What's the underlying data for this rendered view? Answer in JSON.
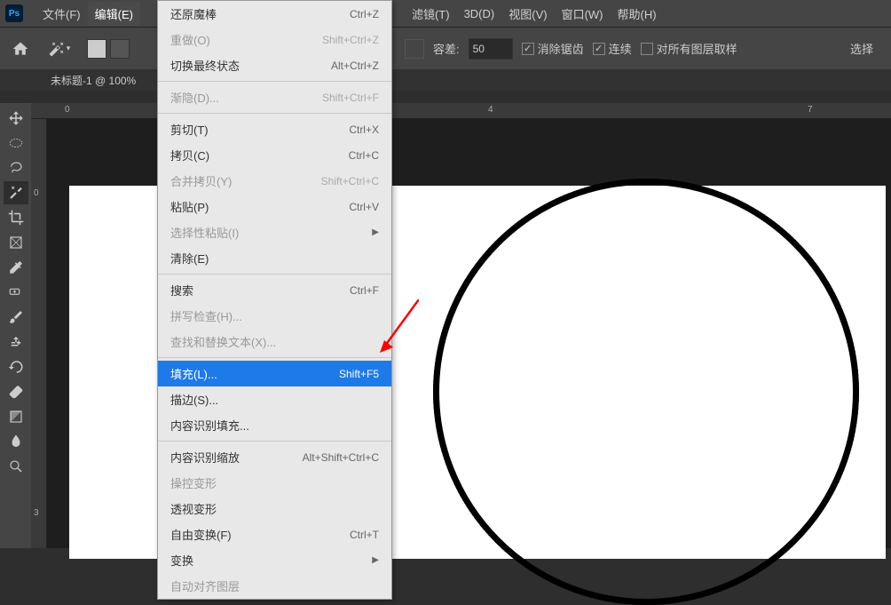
{
  "menubar": {
    "items": [
      {
        "label": "文件(F)"
      },
      {
        "label": "编辑(E)",
        "active": true
      },
      {
        "label": "滤镜(T)"
      },
      {
        "label": "3D(D)"
      },
      {
        "label": "视图(V)"
      },
      {
        "label": "窗口(W)"
      },
      {
        "label": "帮助(H)"
      }
    ]
  },
  "options": {
    "tolerance_label": "容差:",
    "tolerance_value": "50",
    "antialias": "消除锯齿",
    "contiguous": "连续",
    "sample_all": "对所有图层取样",
    "select_subject": "选择"
  },
  "tab": {
    "title": "未标题-1 @ 100%"
  },
  "ruler_h": [
    "0",
    "4",
    "7"
  ],
  "ruler_v": [
    "0",
    "3"
  ],
  "dropdown": {
    "groups": [
      [
        {
          "label": "还原魔棒",
          "shortcut": "Ctrl+Z"
        },
        {
          "label": "重做(O)",
          "shortcut": "Shift+Ctrl+Z",
          "disabled": true
        },
        {
          "label": "切换最终状态",
          "shortcut": "Alt+Ctrl+Z"
        }
      ],
      [
        {
          "label": "渐隐(D)...",
          "shortcut": "Shift+Ctrl+F",
          "disabled": true
        }
      ],
      [
        {
          "label": "剪切(T)",
          "shortcut": "Ctrl+X"
        },
        {
          "label": "拷贝(C)",
          "shortcut": "Ctrl+C"
        },
        {
          "label": "合并拷贝(Y)",
          "shortcut": "Shift+Ctrl+C",
          "disabled": true
        },
        {
          "label": "粘贴(P)",
          "shortcut": "Ctrl+V"
        },
        {
          "label": "选择性粘贴(I)",
          "submenu": true,
          "disabled": true
        },
        {
          "label": "清除(E)"
        }
      ],
      [
        {
          "label": "搜索",
          "shortcut": "Ctrl+F"
        },
        {
          "label": "拼写检查(H)...",
          "disabled": true
        },
        {
          "label": "查找和替换文本(X)...",
          "disabled": true
        }
      ],
      [
        {
          "label": "填充(L)...",
          "shortcut": "Shift+F5",
          "highlighted": true
        },
        {
          "label": "描边(S)..."
        },
        {
          "label": "内容识别填充..."
        }
      ],
      [
        {
          "label": "内容识别缩放",
          "shortcut": "Alt+Shift+Ctrl+C"
        },
        {
          "label": "操控变形",
          "disabled": true
        },
        {
          "label": "透视变形"
        },
        {
          "label": "自由变换(F)",
          "shortcut": "Ctrl+T"
        },
        {
          "label": "变换",
          "submenu": true
        },
        {
          "label": "自动对齐图层",
          "disabled": true
        }
      ]
    ]
  }
}
